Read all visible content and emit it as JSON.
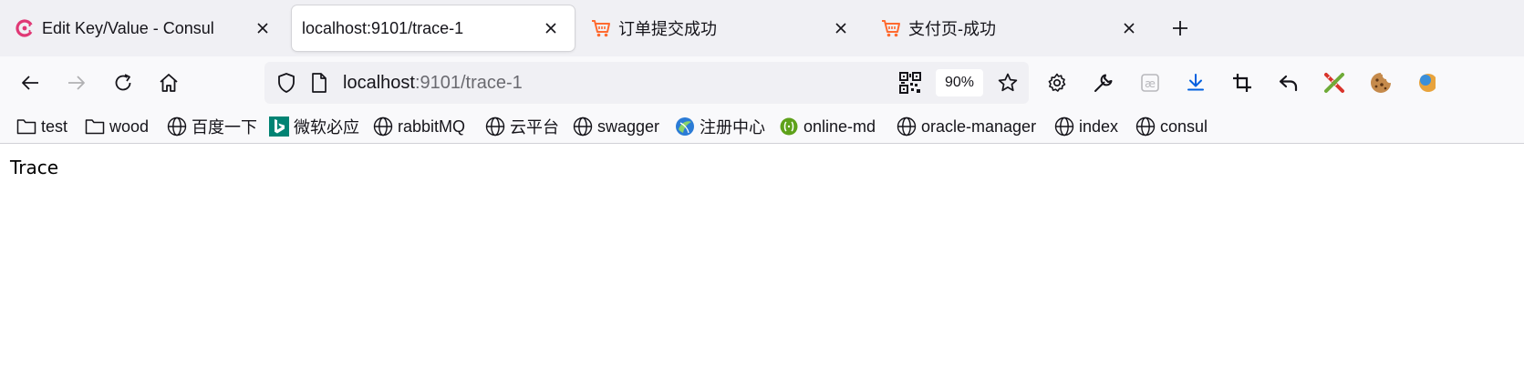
{
  "tabs": [
    {
      "title": "Edit Key/Value - Consul",
      "icon": "consul-icon",
      "active": false
    },
    {
      "title": "localhost:9101/trace-1",
      "icon": "none",
      "active": true
    },
    {
      "title": "订单提交成功",
      "icon": "shopping-cart-icon",
      "active": false
    },
    {
      "title": "支付页-成功",
      "icon": "shopping-cart-icon",
      "active": false
    }
  ],
  "toolbar": {
    "url_host": "localhost",
    "url_rest": ":9101/trace-1",
    "zoom": "90%"
  },
  "bookmarks": [
    {
      "label": "test",
      "icon": "folder-icon"
    },
    {
      "label": "wood",
      "icon": "folder-icon"
    },
    {
      "label": "百度一下",
      "icon": "globe-icon"
    },
    {
      "label": "微软必应",
      "icon": "bing-icon"
    },
    {
      "label": "rabbitMQ",
      "icon": "globe-icon"
    },
    {
      "label": "云平台",
      "icon": "globe-icon"
    },
    {
      "label": "swagger",
      "icon": "globe-icon"
    },
    {
      "label": "注册中心",
      "icon": "spring-icon"
    },
    {
      "label": "online-md",
      "icon": "green-circle-icon"
    },
    {
      "label": "oracle-manager",
      "icon": "globe-icon"
    },
    {
      "label": "index",
      "icon": "globe-icon"
    },
    {
      "label": "consul",
      "icon": "globe-icon"
    }
  ],
  "page": {
    "heading": "Trace"
  },
  "colors": {
    "tabstrip_bg": "#f0f0f4",
    "toolbar_bg": "#f9f9fb",
    "download_blue": "#0060df",
    "cart_orange": "#ff6a2f",
    "consul_pink": "#e03875",
    "bing_teal": "#008373"
  }
}
